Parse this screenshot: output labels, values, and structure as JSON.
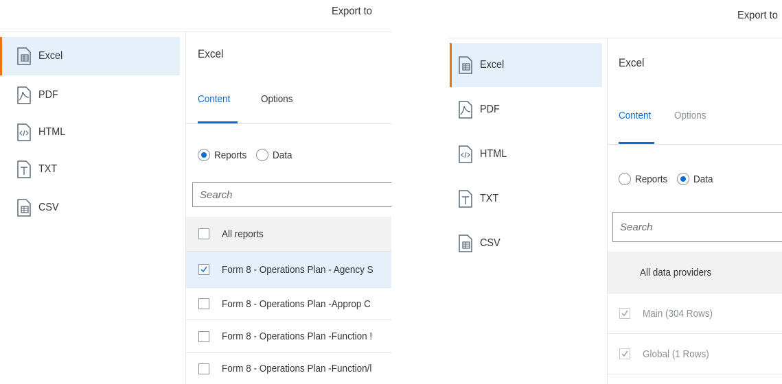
{
  "panels": [
    {
      "header": {
        "title": "Export to"
      },
      "nav": [
        {
          "label": "Excel",
          "icon": "excel-icon",
          "selected": true
        },
        {
          "label": "PDF",
          "icon": "pdf-icon"
        },
        {
          "label": "HTML",
          "icon": "html-icon"
        },
        {
          "label": "TXT",
          "icon": "txt-icon"
        },
        {
          "label": "CSV",
          "icon": "csv-icon"
        }
      ],
      "content": {
        "title": "Excel",
        "tabs": [
          {
            "label": "Content",
            "active": true
          },
          {
            "label": "Options"
          }
        ],
        "radios": [
          {
            "label": "Reports",
            "checked": true
          },
          {
            "label": "Data",
            "checked": false
          }
        ],
        "search": {
          "placeholder": "Search"
        },
        "list_header": {
          "label": "All reports"
        },
        "rows": [
          {
            "label": "Form 8 - Operations Plan - Agency S",
            "checked": true
          },
          {
            "label": "Form 8 - Operations Plan -Approp C",
            "checked": false
          },
          {
            "label": "Form 8 - Operations Plan -Function !",
            "checked": false
          },
          {
            "label": "Form 8 - Operations Plan -Function/l",
            "checked": false
          }
        ]
      }
    },
    {
      "header": {
        "title": "Export to"
      },
      "nav": [
        {
          "label": "Excel",
          "icon": "excel-icon",
          "selected": true
        },
        {
          "label": "PDF",
          "icon": "pdf-icon"
        },
        {
          "label": "HTML",
          "icon": "html-icon"
        },
        {
          "label": "TXT",
          "icon": "txt-icon"
        },
        {
          "label": "CSV",
          "icon": "csv-icon"
        }
      ],
      "content": {
        "title": "Excel",
        "tabs": [
          {
            "label": "Content",
            "active": true
          },
          {
            "label": "Options",
            "disabled": true
          }
        ],
        "radios": [
          {
            "label": "Reports",
            "checked": false
          },
          {
            "label": "Data",
            "checked": true
          }
        ],
        "search": {
          "placeholder": "Search"
        },
        "list_header": {
          "label": "All data providers"
        },
        "rows": [
          {
            "label": "Main (304 Rows)",
            "checked": true,
            "disabled": true
          },
          {
            "label": "Global (1 Rows)",
            "checked": true,
            "disabled": true
          }
        ]
      }
    }
  ],
  "colors": {
    "accent": "#0a6ed1",
    "selection": "#e5f0fa",
    "nav_marker": "#e9730c"
  }
}
